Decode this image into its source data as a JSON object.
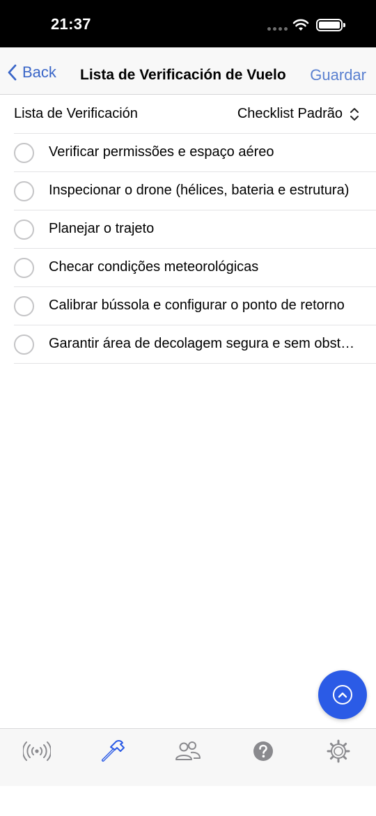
{
  "status_bar": {
    "time": "21:37"
  },
  "navbar": {
    "back_label": "Back",
    "title": "Lista de Verificación de Vuelo",
    "save_label": "Guardar"
  },
  "checklist_selector": {
    "label": "Lista de Verificación",
    "value": "Checklist Padrão"
  },
  "checklist": {
    "items": [
      {
        "text": "Verificar permissões e espaço aéreo",
        "checked": false
      },
      {
        "text": "Inspecionar o drone (hélices, bateria e estrutura)",
        "checked": false
      },
      {
        "text": "Planejar o trajeto",
        "checked": false
      },
      {
        "text": "Checar condições meteorológicas",
        "checked": false
      },
      {
        "text": "Calibrar bússola e configurar o ponto de retorno",
        "checked": false
      },
      {
        "text": "Garantir área de decolagem segura e sem obstáculos",
        "checked": false
      }
    ]
  },
  "fab": {
    "icon": "chevron-up-icon"
  },
  "tabbar": {
    "tabs": [
      {
        "icon": "broadcast-icon",
        "active": false
      },
      {
        "icon": "hammer-icon",
        "active": true
      },
      {
        "icon": "people-icon",
        "active": false
      },
      {
        "icon": "help-icon",
        "active": false
      },
      {
        "icon": "gear-icon",
        "active": false
      }
    ]
  },
  "colors": {
    "accent": "#3a66c8",
    "fab": "#2b5be6",
    "tab_inactive": "#8a8a8e"
  }
}
